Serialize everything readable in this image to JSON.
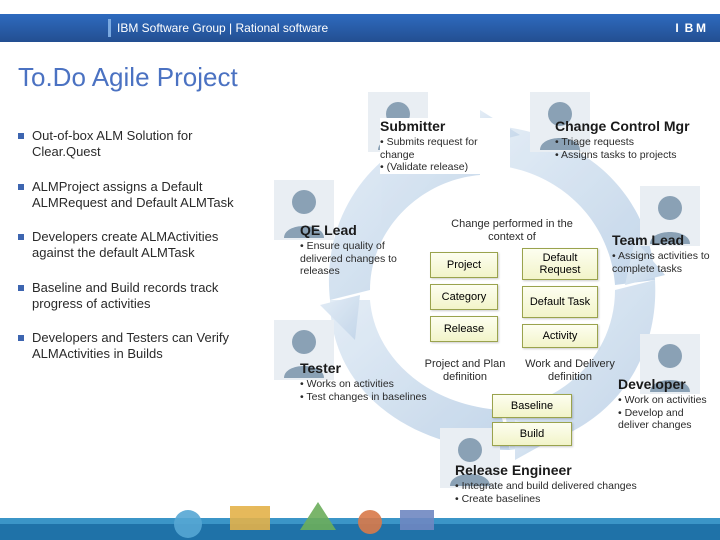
{
  "header": {
    "breadcrumb": "IBM Software Group | Rational software",
    "logo_text": "IBM"
  },
  "title": "To.Do Agile Project",
  "bullets": [
    "Out-of-box ALM Solution for Clear.Quest",
    "ALMProject assigns a Default ALMRequest and Default ALMTask",
    "Developers create ALMActivities against the default ALMTask",
    "Baseline and Build records track progress of activities",
    "Developers and Testers can Verify ALMActivities in Builds"
  ],
  "roles": {
    "submitter": {
      "name": "Submitter",
      "points": [
        "Submits request for change",
        "(Validate release)"
      ]
    },
    "ccm": {
      "name": "Change Control Mgr",
      "points": [
        "Triage requests",
        "Assigns tasks to projects"
      ]
    },
    "qe": {
      "name": "QE Lead",
      "points": [
        "Ensure quality of delivered changes to releases"
      ]
    },
    "teamlead": {
      "name": "Team Lead",
      "points": [
        "Assigns activities to complete tasks"
      ]
    },
    "tester": {
      "name": "Tester",
      "points": [
        "Works on activities",
        "Test changes in baselines"
      ]
    },
    "developer": {
      "name": "Developer",
      "points": [
        "Work on activities",
        "Develop and deliver changes"
      ]
    },
    "releng": {
      "name": "Release Engineer",
      "points": [
        "Integrate and build delivered changes",
        "Create baselines"
      ]
    }
  },
  "context": {
    "heading": "Change performed in the context of",
    "left": [
      "Project",
      "Category",
      "Release"
    ],
    "right": [
      "Default Request",
      "Default Task",
      "Activity"
    ],
    "pair_left": "Project and Plan definition",
    "pair_right": "Work and Delivery definition",
    "bottom": [
      "Baseline",
      "Build"
    ]
  }
}
